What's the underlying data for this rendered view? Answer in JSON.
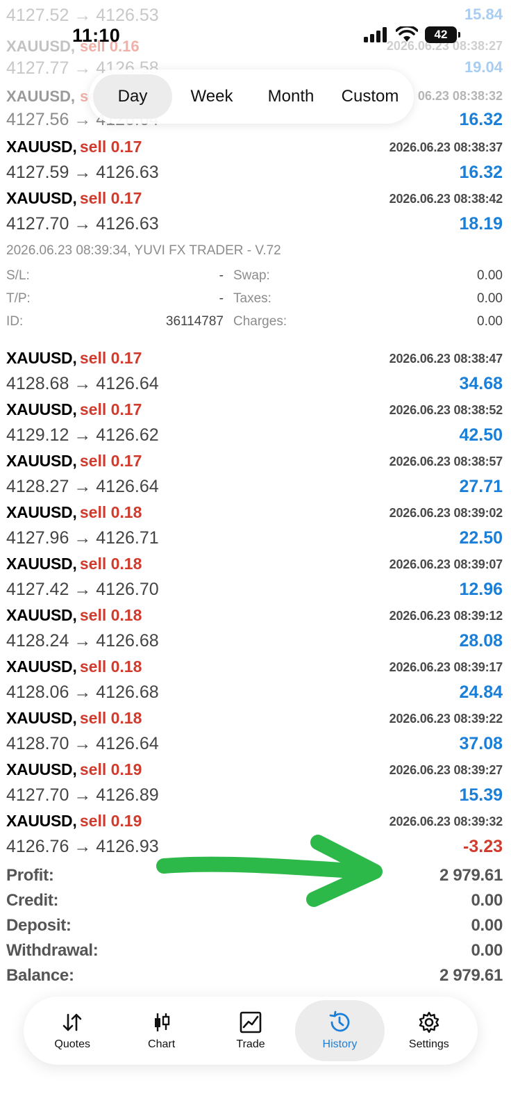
{
  "status_bar": {
    "time": "11:10",
    "battery": "42"
  },
  "period_tabs": [
    {
      "label": "Day",
      "active": true
    },
    {
      "label": "Week",
      "active": false
    },
    {
      "label": "Month",
      "active": false
    },
    {
      "label": "Custom",
      "active": false
    }
  ],
  "faded_rows": {
    "row1_prices": "4127.52 → 4126.53",
    "row1_profit": "15.84",
    "row2_symbol": "XAUUSD,",
    "row2_side": "sell 0.16",
    "row2_time": "2026.06.23 08:38:27",
    "row3_prices": "4127.77 → 4126.58",
    "row3_profit": "19.04",
    "row4_symbol": "XAUUSD,",
    "row4_side": "se",
    "row4_time": "06.23 08:38:32",
    "row4_prices": "4127.56 → 4126.64",
    "row4_profit": "16.32"
  },
  "deals": [
    {
      "symbol": "XAUUSD,",
      "side": "sell 0.17",
      "time": "2026.06.23 08:38:37",
      "prices": "4127.59 → 4126.63",
      "profit": "16.32",
      "negative": false
    },
    {
      "symbol": "XAUUSD,",
      "side": "sell 0.17",
      "time": "2026.06.23 08:38:42",
      "prices": "4127.70 → 4126.63",
      "profit": "18.19",
      "negative": false
    },
    {
      "symbol": "XAUUSD,",
      "side": "sell 0.17",
      "time": "2026.06.23 08:38:47",
      "prices": "4128.68 → 4126.64",
      "profit": "34.68",
      "negative": false
    },
    {
      "symbol": "XAUUSD,",
      "side": "sell 0.17",
      "time": "2026.06.23 08:38:52",
      "prices": "4129.12 → 4126.62",
      "profit": "42.50",
      "negative": false
    },
    {
      "symbol": "XAUUSD,",
      "side": "sell 0.17",
      "time": "2026.06.23 08:38:57",
      "prices": "4128.27 → 4126.64",
      "profit": "27.71",
      "negative": false
    },
    {
      "symbol": "XAUUSD,",
      "side": "sell 0.18",
      "time": "2026.06.23 08:39:02",
      "prices": "4127.96 → 4126.71",
      "profit": "22.50",
      "negative": false
    },
    {
      "symbol": "XAUUSD,",
      "side": "sell 0.18",
      "time": "2026.06.23 08:39:07",
      "prices": "4127.42 → 4126.70",
      "profit": "12.96",
      "negative": false
    },
    {
      "symbol": "XAUUSD,",
      "side": "sell 0.18",
      "time": "2026.06.23 08:39:12",
      "prices": "4128.24 → 4126.68",
      "profit": "28.08",
      "negative": false
    },
    {
      "symbol": "XAUUSD,",
      "side": "sell 0.18",
      "time": "2026.06.23 08:39:17",
      "prices": "4128.06 → 4126.68",
      "profit": "24.84",
      "negative": false
    },
    {
      "symbol": "XAUUSD,",
      "side": "sell 0.18",
      "time": "2026.06.23 08:39:22",
      "prices": "4128.70 → 4126.64",
      "profit": "37.08",
      "negative": false
    },
    {
      "symbol": "XAUUSD,",
      "side": "sell 0.19",
      "time": "2026.06.23 08:39:27",
      "prices": "4127.70 → 4126.89",
      "profit": "15.39",
      "negative": false
    },
    {
      "symbol": "XAUUSD,",
      "side": "sell 0.19",
      "time": "2026.06.23 08:39:32",
      "prices": "4126.76 → 4126.93",
      "profit": "-3.23",
      "negative": true
    }
  ],
  "detail": {
    "header": "2026.06.23 08:39:34, YUVI FX TRADER - V.72",
    "sl_label": "S/L:",
    "sl_value": "-",
    "tp_label": "T/P:",
    "tp_value": "-",
    "id_label": "ID:",
    "id_value": "36114787",
    "swap_label": "Swap:",
    "swap_value": "0.00",
    "taxes_label": "Taxes:",
    "taxes_value": "0.00",
    "charges_label": "Charges:",
    "charges_value": "0.00"
  },
  "summary": {
    "profit_label": "Profit:",
    "profit_value": "2 979.61",
    "credit_label": "Credit:",
    "credit_value": "0.00",
    "deposit_label": "Deposit:",
    "deposit_value": "0.00",
    "withdrawal_label": "Withdrawal:",
    "withdrawal_value": "0.00",
    "balance_label": "Balance:",
    "balance_value": "2 979.61"
  },
  "tabbar": [
    {
      "label": "Quotes",
      "icon": "quotes-icon",
      "active": false
    },
    {
      "label": "Chart",
      "icon": "chart-icon",
      "active": false
    },
    {
      "label": "Trade",
      "icon": "trade-icon",
      "active": false
    },
    {
      "label": "History",
      "icon": "history-icon",
      "active": true
    },
    {
      "label": "Settings",
      "icon": "gear-icon",
      "active": false
    }
  ],
  "colors": {
    "profit_positive": "#1a7fd9",
    "sell": "#d03b2d",
    "annotation_arrow": "#2db84a"
  }
}
